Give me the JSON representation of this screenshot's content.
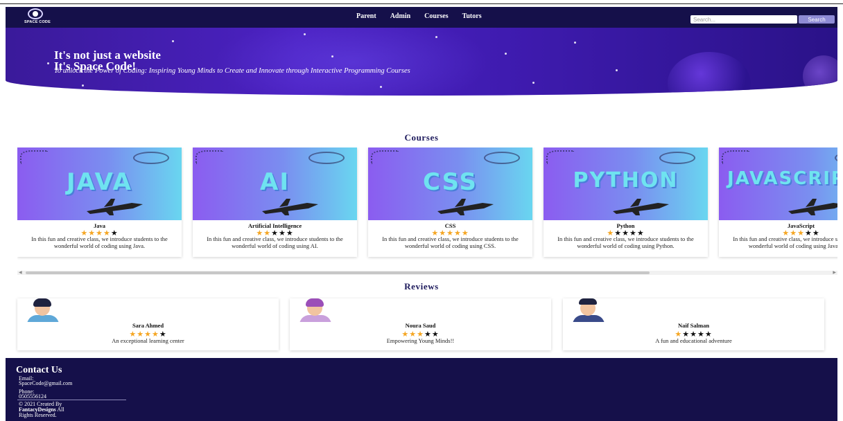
{
  "nav": {
    "logo_text": "SPACE CODE",
    "links": [
      "Parent",
      "Admin",
      "Courses",
      "Tutors"
    ],
    "search_placeholder": "Search...",
    "search_button": "Search"
  },
  "hero": {
    "title_line1": "It's not just a website",
    "title_line2": "It's Space Code!",
    "subtitle": "To unlock the Power of Coding: Inspiring Young Minds to Create and Innovate through Interactive Programming Courses"
  },
  "courses": {
    "heading": "Courses",
    "items": [
      {
        "image_word": "JAVA",
        "name": "Java",
        "rating": 4,
        "max_rating": 5,
        "description": "In this fun and creative class, we introduce students to the wonderful world of coding using Java."
      },
      {
        "image_word": "AI",
        "name": "Artificial Intelligence",
        "rating": 2,
        "max_rating": 5,
        "description": "In this fun and creative class, we introduce students to the wonderful world of coding using AI."
      },
      {
        "image_word": "CSS",
        "name": "CSS",
        "rating": 5,
        "max_rating": 5,
        "description": "In this fun and creative class, we introduce students to the wonderful world of coding using CSS."
      },
      {
        "image_word": "PYTHON",
        "name": "Python",
        "rating": 1,
        "max_rating": 5,
        "description": "In this fun and creative class, we introduce students to the wonderful world of coding using Python."
      },
      {
        "image_word": "JAVASCRIPT",
        "name": "JavaScript",
        "rating": 3,
        "max_rating": 5,
        "description": "In this fun and creative class, we introduce students to the wonderful world of coding using JavaScript."
      }
    ]
  },
  "reviews": {
    "heading": "Reviews",
    "items": [
      {
        "name": "Sara Ahmed",
        "rating": 4,
        "max_rating": 5,
        "text": "An exceptional learning center"
      },
      {
        "name": "Noura Saud",
        "rating": 3,
        "max_rating": 5,
        "text": "Empowering Young Minds!!"
      },
      {
        "name": "Naif Salman",
        "rating": 1,
        "max_rating": 5,
        "text": "A fun and educational adventure"
      }
    ]
  },
  "footer": {
    "title": "Contact Us",
    "email_label": "Email:",
    "email_value": "SpaceCode@gmail.com",
    "phone_label": "Phone:",
    "phone_value": "0505556124",
    "copyright_line1": "© 2021 Created By",
    "copyright_brand": "FantacyDesigns",
    "copyright_suffix": " All",
    "copyright_line3": "Rights Reserved."
  },
  "colors": {
    "navbar_bg": "#15104a",
    "hero_bg": "#4b21c2",
    "heading_color": "#1d1a5c",
    "star_on": "#f5a623",
    "star_off": "#111111",
    "search_button_bg": "#8e8bd4"
  }
}
